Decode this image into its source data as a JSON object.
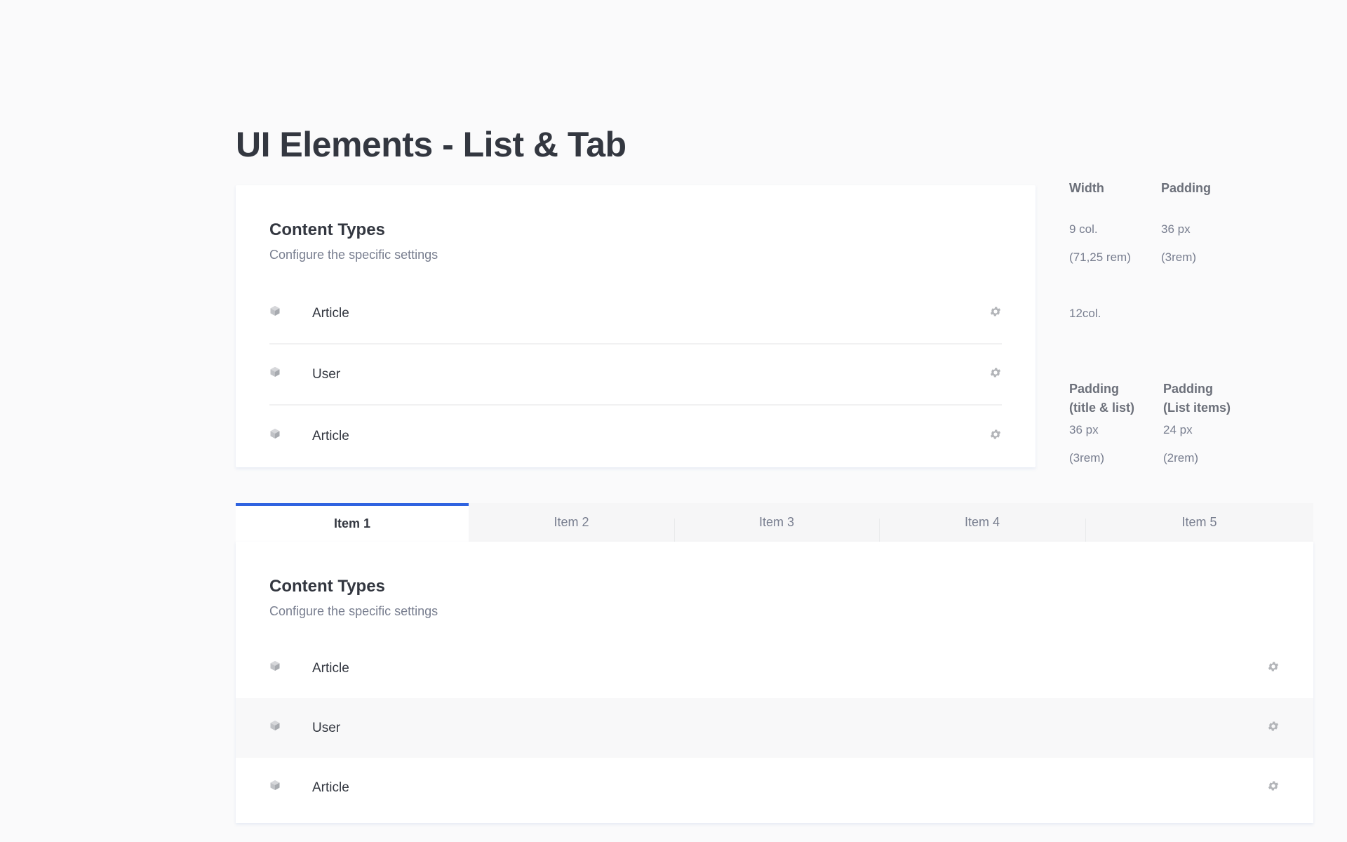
{
  "page_title": "UI Elements - List & Tab",
  "card1": {
    "title": "Content Types",
    "subtitle": "Configure the specific settings",
    "items": [
      {
        "label": "Article",
        "icon": "cube-icon",
        "action_icon": "gear-icon"
      },
      {
        "label": "User",
        "icon": "cube-icon",
        "action_icon": "gear-icon"
      },
      {
        "label": "Article",
        "icon": "cube-icon",
        "action_icon": "gear-icon"
      }
    ]
  },
  "specs": {
    "width_label": "Width",
    "padding_label": "Padding",
    "width_cols": "9 col.",
    "width_rem": "(71,25 rem)",
    "padding_px": "36 px",
    "padding_rem": "(3rem)",
    "cols_12": "12col.",
    "padding_title_list_label_1": "Padding",
    "padding_title_list_label_2": "(title & list)",
    "padding_list_items_label_1": "Padding",
    "padding_list_items_label_2": "(List items)",
    "padding_title_list_px": "36 px",
    "padding_title_list_rem": "(3rem)",
    "padding_list_items_px": "24 px",
    "padding_list_items_rem": "(2rem)"
  },
  "tabs": [
    {
      "label": "Item 1",
      "active": true
    },
    {
      "label": "Item 2",
      "active": false
    },
    {
      "label": "Item 3",
      "active": false
    },
    {
      "label": "Item 4",
      "active": false
    },
    {
      "label": "Item 5",
      "active": false
    }
  ],
  "card2": {
    "title": "Content Types",
    "subtitle": "Configure the specific settings",
    "items": [
      {
        "label": "Article",
        "icon": "cube-icon",
        "action_icon": "gear-icon"
      },
      {
        "label": "User",
        "icon": "cube-icon",
        "action_icon": "gear-icon"
      },
      {
        "label": "Article",
        "icon": "cube-icon",
        "action_icon": "gear-icon"
      }
    ]
  },
  "colors": {
    "background": "#fafafb",
    "card": "#ffffff",
    "active_tab_border": "#2f63e0",
    "text_primary": "#333740",
    "text_secondary": "#787e8f",
    "icon": "#b3b5b9"
  }
}
